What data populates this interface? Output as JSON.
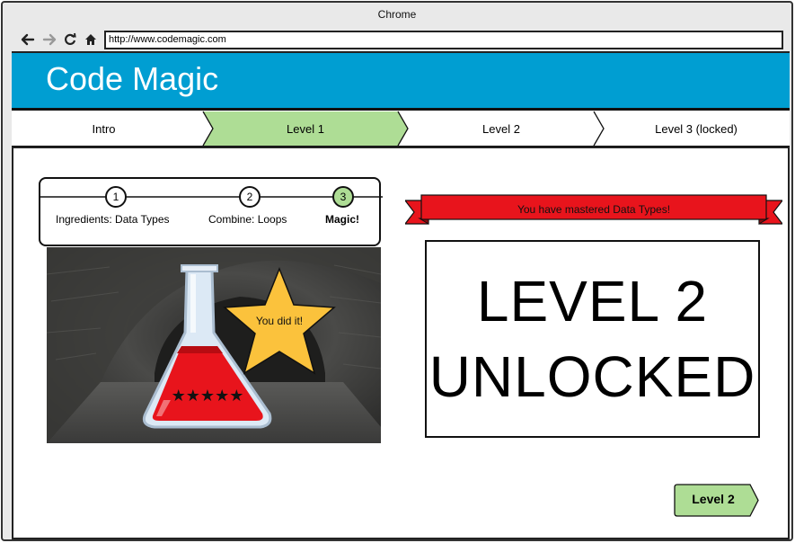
{
  "window": {
    "title": "Chrome"
  },
  "toolbar": {
    "icons": [
      "back-arrow-icon",
      "forward-arrow-icon",
      "reload-icon",
      "home-icon"
    ],
    "url": "http://www.codemagic.com"
  },
  "site": {
    "title": "Code Magic",
    "header_color": "#009ed2"
  },
  "steps": {
    "active_color": "#aedd95",
    "items": [
      {
        "label": "Intro",
        "active": false
      },
      {
        "label": "Level 1",
        "active": true
      },
      {
        "label": "Level 2",
        "active": false
      },
      {
        "label": "Level 3 (locked)",
        "active": false
      }
    ]
  },
  "progress": {
    "items": [
      {
        "number": "1",
        "label": "Ingredients: Data Types",
        "current": false
      },
      {
        "number": "2",
        "label": "Combine: Loops",
        "current": false
      },
      {
        "number": "3",
        "label": "Magic!",
        "current": true
      }
    ]
  },
  "scene": {
    "star_text": "You did it!",
    "rating_stars": "★★★★★",
    "potion_color": "#e8141c",
    "star_color": "#fbc23c"
  },
  "banner": {
    "text": "You have mastered Data Types!",
    "color": "#e8141c"
  },
  "unlock": {
    "line1": "LEVEL 2",
    "line2": "UNLOCKED"
  },
  "next_button": {
    "label": "Level 2",
    "color": "#aedd95"
  }
}
